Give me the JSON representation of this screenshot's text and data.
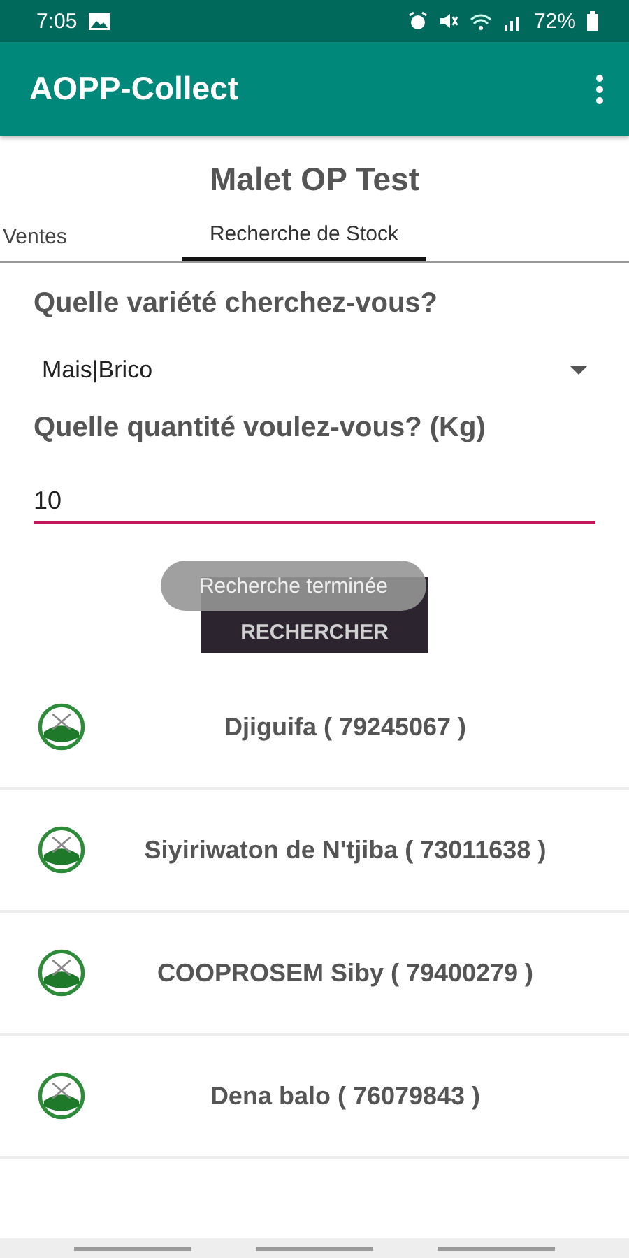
{
  "status_bar": {
    "time": "7:05",
    "battery": "72%"
  },
  "app_bar": {
    "title": "AOPP-Collect"
  },
  "page_title": "Malet OP Test",
  "tabs": [
    {
      "label": "Ventes",
      "selected": false
    },
    {
      "label": "Recherche de Stock",
      "selected": true
    }
  ],
  "form": {
    "variety_question": "Quelle variété cherchez-vous?",
    "variety_value": "Mais|Brico",
    "quantity_question": "Quelle quantité voulez-vous? (Kg)",
    "quantity_value": "10",
    "button": "RECHERCHER"
  },
  "toast": "Recherche terminée",
  "results": [
    {
      "label": "Djiguifa ( 79245067 )"
    },
    {
      "label": "Siyiriwaton de N'tjiba ( 73011638 )"
    },
    {
      "label": "COOPROSEM Siby ( 79400279 )"
    },
    {
      "label": "Dena balo ( 76079843 )"
    }
  ]
}
